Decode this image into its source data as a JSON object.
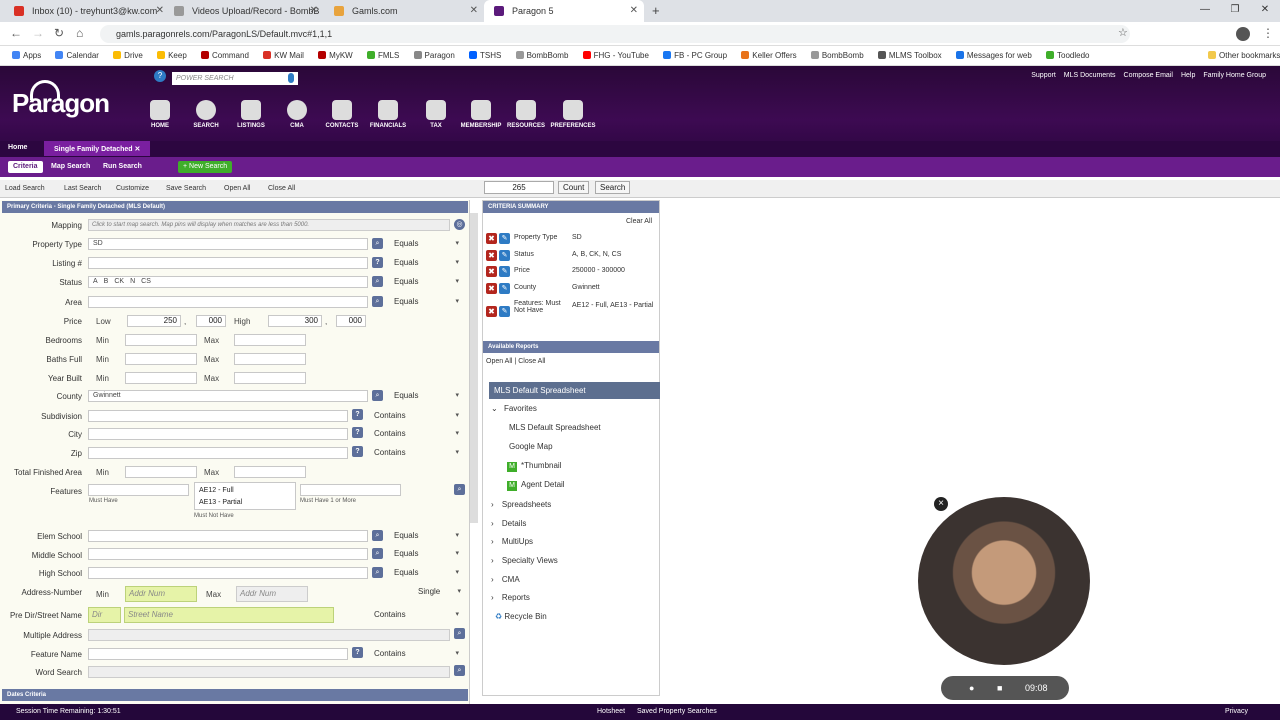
{
  "browser": {
    "tabs": [
      {
        "title": "Inbox (10) - treyhunt3@kw.com",
        "icon_color": "#d93025"
      },
      {
        "title": "Videos Upload/Record - BombB",
        "icon_color": "#666666"
      },
      {
        "title": "Gamls.com",
        "icon_color": "#e8a33d"
      },
      {
        "title": "Paragon 5",
        "icon_color": "#5b1a7b"
      }
    ],
    "new_tab": "+",
    "url": "gamls.paragonrels.com/ParagonLS/Default.mvc#1,1,1",
    "bookmarks": [
      "Apps",
      "Calendar",
      "Drive",
      "Keep",
      "Command",
      "KW Mail",
      "MyKW",
      "FMLS",
      "Paragon",
      "TSHS",
      "BombBomb",
      "FHG - YouTube",
      "FB - PC Group",
      "Keller Offers",
      "BombBomb",
      "MLMS Toolbox",
      "Messages for web",
      "Toodledo"
    ],
    "other_bookmarks": "Other bookmarks"
  },
  "app": {
    "logo": "Paragon",
    "power_search_placeholder": "POWER SEARCH",
    "nav": [
      "HOME",
      "SEARCH",
      "LISTINGS",
      "CMA",
      "CONTACTS",
      "FINANCIALS",
      "TAX",
      "MEMBERSHIP",
      "RESOURCES",
      "PREFERENCES"
    ],
    "top_links": [
      "Support",
      "MLS Documents",
      "Compose Email",
      "Help",
      "Family Home Group"
    ],
    "tabs": {
      "home": "Home",
      "active": "Single Family Detached"
    },
    "subnav": [
      "Criteria",
      "Map Search",
      "Run Search"
    ],
    "new_search": "+ New Search",
    "toolbar": [
      "Load Search",
      "Last Search",
      "Customize",
      "Save Search",
      "Open All",
      "Close All"
    ],
    "count_value": "265",
    "count_btn": "Count",
    "search_btn": "Search"
  },
  "criteria": {
    "header": "Primary Criteria - Single Family Detached (MLS Default)",
    "mapping_label": "Mapping",
    "mapping_hint": "Click to start map search. Map pins will display when matches are less than 5000.",
    "property_type": {
      "label": "Property Type",
      "tags": [
        "SD"
      ],
      "op": "Equals"
    },
    "listing": {
      "label": "Listing #",
      "op": "Equals"
    },
    "status": {
      "label": "Status",
      "tags": [
        "A",
        "B",
        "CK",
        "N",
        "CS"
      ],
      "op": "Equals"
    },
    "area": {
      "label": "Area",
      "op": "Equals"
    },
    "price": {
      "label": "Price",
      "low": "Low",
      "low_val": "250",
      "low_k": "000",
      "high": "High",
      "high_val": "300",
      "high_k": "000",
      "comma": ","
    },
    "bedrooms": "Bedrooms",
    "baths": "Baths Full",
    "year": "Year Built",
    "min": "Min",
    "max": "Max",
    "county": {
      "label": "County",
      "tags": [
        "Gwinnett"
      ],
      "op": "Equals"
    },
    "subdivision": {
      "label": "Subdivision",
      "op": "Contains"
    },
    "city": {
      "label": "City",
      "op": "Contains"
    },
    "zip": {
      "label": "Zip",
      "op": "Contains"
    },
    "tfa": "Total Finished Area",
    "features": {
      "label": "Features",
      "must_have": "Must Have",
      "must_not": [
        "AE12 - Full",
        "AE13 - Partial"
      ],
      "must_not_label": "Must Not Have",
      "one_or_more": "Must Have 1 or More"
    },
    "elem": {
      "label": "Elem School",
      "op": "Equals"
    },
    "middle": {
      "label": "Middle School",
      "op": "Equals"
    },
    "high": {
      "label": "High School",
      "op": "Equals"
    },
    "addr": {
      "label": "Address-Number",
      "ph": "Addr Num",
      "op": "Single"
    },
    "street": {
      "label": "Pre Dir/Street Name",
      "dir": "Dir",
      "ph": "Street Name",
      "op": "Contains"
    },
    "multi": "Multiple Address",
    "feature_name": {
      "label": "Feature Name",
      "op": "Contains"
    },
    "word": "Word Search",
    "dates": "Dates Criteria"
  },
  "summary": {
    "header": "CRITERIA SUMMARY",
    "clear": "Clear All",
    "rows": [
      {
        "k": "Property Type",
        "v": "SD"
      },
      {
        "k": "Status",
        "v": "A, B, CK, N, CS"
      },
      {
        "k": "Price",
        "v": "250000 - 300000"
      },
      {
        "k": "County",
        "v": "Gwinnett"
      },
      {
        "k": "Features: Must Not Have",
        "v": "AE12 - Full, AE13 - Partial"
      }
    ],
    "reports_header": "Available Reports",
    "open_all": "Open All",
    "sep": "|",
    "close_all": "Close All",
    "selected": "MLS Default Spreadsheet",
    "favorites": "Favorites",
    "fav_items": [
      "MLS Default Spreadsheet",
      "Google Map",
      "*Thumbnail",
      "Agent Detail"
    ],
    "groups": [
      "Spreadsheets",
      "Details",
      "MultiUps",
      "Specialty Views",
      "CMA",
      "Reports"
    ],
    "recycle": "Recycle Bin"
  },
  "cam": {
    "close": "×",
    "time": "09:08"
  },
  "status": {
    "session": "Session Time Remaining: 1:30:51",
    "links": [
      "Hotsheet",
      "Saved Property Searches"
    ],
    "privacy": "Privacy"
  }
}
